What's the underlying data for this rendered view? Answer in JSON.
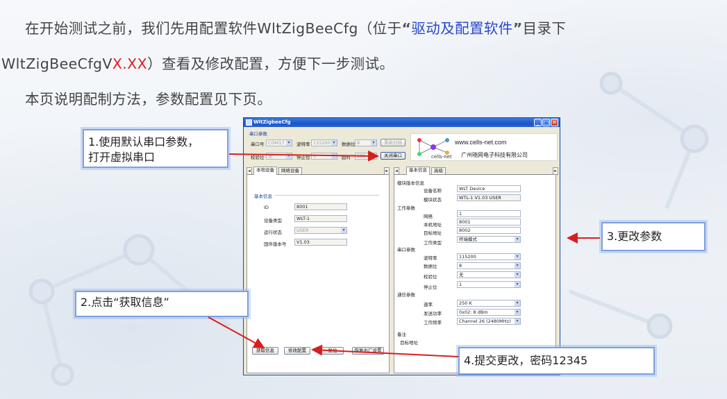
{
  "intro": {
    "line1_pre": "在开始测试之前，我们先用配置软件WltZigBeeCfg（位于",
    "quote_open": "“",
    "folder_name": "驱动及配置软件",
    "quote_close": "”",
    "line1_post": "目录下",
    "line2_pre": "WltZigBeeCfgV",
    "version_placeholder": "X.XX",
    "line2_post": "）查看及修改配置，方便下一步测试。",
    "line3": "本页说明配制方法，参数配置见下页。"
  },
  "window": {
    "title": "WltZigbeeCfg",
    "title_bar_color": "#1d55c6",
    "min_glyph": "_",
    "max_glyph": "□",
    "close_glyph": "✕"
  },
  "serial": {
    "group_title": "串口参数",
    "port_label": "串口号",
    "port_value": "COM17",
    "baud_label": "波特率",
    "baud_value": "115200",
    "data_bits_label": "数据位",
    "data_bits_value": "8",
    "rescan_button": "重新扫描",
    "parity_label": "校验位",
    "parity_value": "无",
    "stop_bits_label": "停止位",
    "stop_bits_value": "1",
    "timeout_label": "超时",
    "timeout_value": "500",
    "close_port_button": "关闭串口"
  },
  "logo": {
    "url": "www.cells-net.com",
    "company": "广州晓网电子科技有限公司",
    "name": "cells-net"
  },
  "left_tabs": [
    "本地设备",
    "网络设备"
  ],
  "right_tabs": [
    "基本信息",
    "高级"
  ],
  "basic_info": {
    "title": "基本信息",
    "id_label": "ID",
    "id_value": "8001",
    "type_label": "设备类型",
    "type_value": "WLT-1",
    "state_label": "运行状态",
    "state_value": "USER",
    "fw_label": "固件版本号",
    "fw_value": "V1.03"
  },
  "module": {
    "version_group": "模块版本信息",
    "device_name_label": "设备名称",
    "device_name_value": "WLT Device",
    "module_state_label": "模块状态",
    "module_state_value": "WTL-1 V1.03 USER",
    "work_group": "工作参数",
    "net_label": "网络",
    "net_value": "1",
    "local_addr_label": "本机地址",
    "local_addr_value": "8001",
    "target_addr_label": "目标地址",
    "target_addr_value": "8002",
    "work_type_label": "工作类型",
    "work_type_value": "终端模式",
    "serial_group": "串口参数",
    "baud_label": "波特率",
    "baud_value": "115200",
    "data_bits_label": "数据位",
    "data_bits_value": "8",
    "parity_label": "校验位",
    "parity_value": "无",
    "stop_bits_label": "停止位",
    "stop_bits_value": "1",
    "comm_group": "通信参数",
    "rate_label": "速率",
    "rate_value": "250 K",
    "power_label": "发送功率",
    "power_value": "0x02: 8    dBm",
    "freq_label": "工作频率",
    "freq_value": "Channel 26 (2480MHz)",
    "backup_group": "备注",
    "backup_target_label": "目标地址"
  },
  "bottom_buttons": {
    "get_info": "获取信息",
    "modify": "修改配置",
    "reset": "复位",
    "factory": "恢复出厂设置"
  },
  "callouts": {
    "step1_line1": "1.使用默认串口参数，",
    "step1_line2": "打开虚拟串口",
    "step2": "2.点击“获取信息”",
    "step3": "3.更改参数",
    "step4": "4.提交更改，密码12345"
  },
  "colors": {
    "text": "#444444",
    "folder_blue": "#2a47c8",
    "placeholder_red": "#e02020",
    "arrow_red": "#d81e1e",
    "callout_border": "#7da0e0"
  }
}
